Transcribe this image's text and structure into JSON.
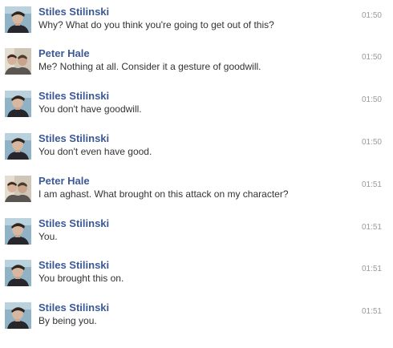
{
  "colors": {
    "name_link": "#3b5998",
    "message_text": "#333333",
    "timestamp": "#999999",
    "background": "#ffffff"
  },
  "messages": [
    {
      "sender": "Stiles Stilinski",
      "avatar": "stiles-avatar",
      "text": "Why? What do you think you're going to get out of this?",
      "time": "01:50"
    },
    {
      "sender": "Peter Hale",
      "avatar": "peter-avatar",
      "text": "Me? Nothing at all. Consider it a gesture of goodwill.",
      "time": "01:50"
    },
    {
      "sender": "Stiles Stilinski",
      "avatar": "stiles-avatar",
      "text": "You don't have goodwill.",
      "time": "01:50"
    },
    {
      "sender": "Stiles Stilinski",
      "avatar": "stiles-avatar",
      "text": "You don't even have good.",
      "time": "01:50"
    },
    {
      "sender": "Peter Hale",
      "avatar": "peter-avatar",
      "text": "I am aghast. What brought on this attack on my character?",
      "time": "01:51"
    },
    {
      "sender": "Stiles Stilinski",
      "avatar": "stiles-avatar",
      "text": "You.",
      "time": "01:51"
    },
    {
      "sender": "Stiles Stilinski",
      "avatar": "stiles-avatar",
      "text": "You brought this on.",
      "time": "01:51"
    },
    {
      "sender": "Stiles Stilinski",
      "avatar": "stiles-avatar",
      "text": "By being you.",
      "time": "01:51"
    }
  ]
}
